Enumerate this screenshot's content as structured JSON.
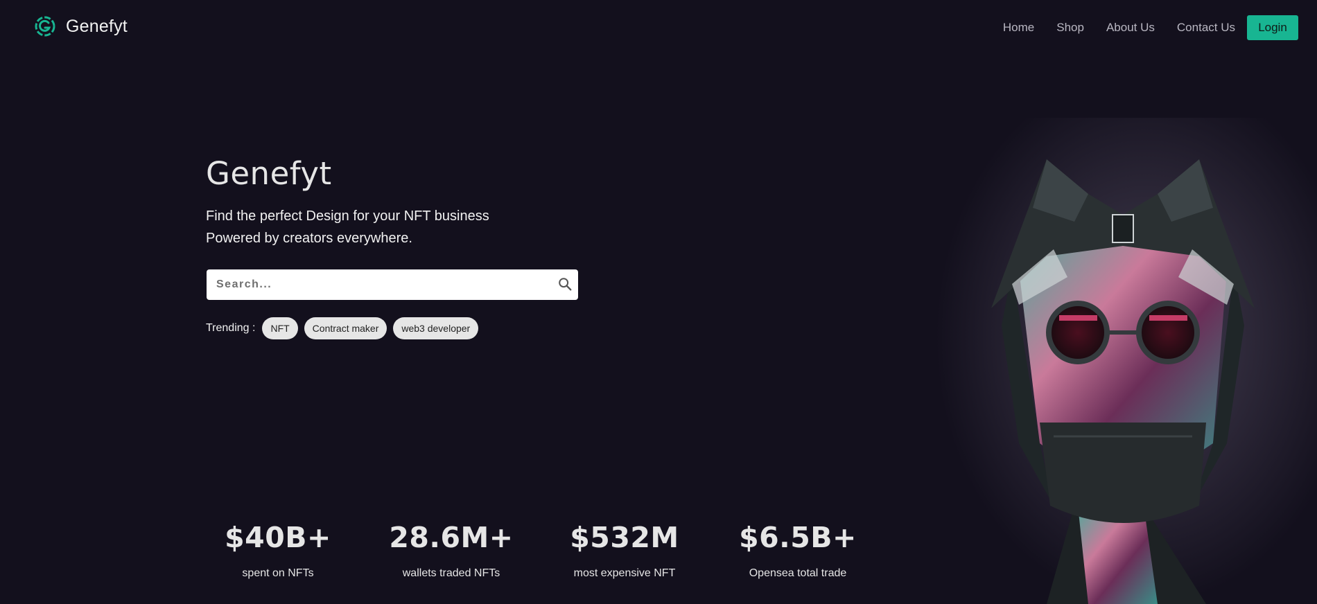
{
  "brand": {
    "name": "Genefyt",
    "accent": "#18b592"
  },
  "nav": {
    "links": [
      "Home",
      "Shop",
      "About Us",
      "Contact Us"
    ],
    "login_label": "Login"
  },
  "hero": {
    "title": "Genefyt",
    "line1": "Find the perfect Design for your NFT business",
    "line2": "Powered by creators everywhere."
  },
  "search": {
    "placeholder": "Search...",
    "icon": "search-icon"
  },
  "trending": {
    "label": "Trending :",
    "tags": [
      "NFT",
      "Contract maker",
      "web3 developer"
    ]
  },
  "stats": [
    {
      "value": "$40B+",
      "label": "spent on NFTs"
    },
    {
      "value": "28.6M+",
      "label": "wallets traded NFTs"
    },
    {
      "value": "$532M",
      "label": "most expensive NFT"
    },
    {
      "value": "$6.5B+",
      "label": "Opensea total trade"
    }
  ],
  "colors": {
    "background": "#13101d",
    "button": "#18b592"
  }
}
